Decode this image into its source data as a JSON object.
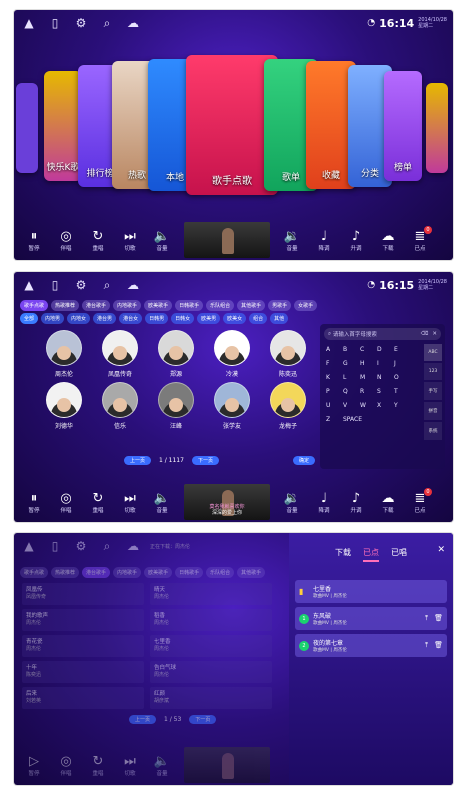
{
  "status": {
    "time1": "16:14",
    "date1": "2014/10/28",
    "week": "星期二",
    "time2": "16:15",
    "date2": "2014/10/28",
    "icons": [
      "android-icon",
      "phone-icon",
      "gear-icon",
      "search-icon",
      "cloud-icon",
      "wifi-icon"
    ]
  },
  "carousel": {
    "left": [
      "快乐K歌",
      "排行榜",
      "热歌",
      "本地"
    ],
    "center": "歌手点歌",
    "right": [
      "歌单",
      "收藏",
      "分类",
      "榜单"
    ]
  },
  "bar": {
    "left": [
      "暂停",
      "伴唱",
      "重唱",
      "切歌",
      "音量"
    ],
    "right": [
      "音量",
      "降调",
      "升调",
      "下载",
      "已点"
    ],
    "badge": "0"
  },
  "video2": {
    "line1": "莫名我就喜欢你",
    "line2": "深深的爱上你"
  },
  "screen2": {
    "tabs": [
      "歌手点歌",
      "热歌推荐",
      "港台歌手",
      "内地歌手",
      "欧美歌手",
      "日韩歌手",
      "乐队组合",
      "其他歌手",
      "男歌手",
      "女歌手"
    ],
    "subtabs": [
      "全部",
      "内地男",
      "内地女",
      "港台男",
      "港台女",
      "日韩男",
      "日韩女",
      "欧美男",
      "欧美女",
      "组合",
      "其他"
    ],
    "singers": [
      "周杰伦",
      "凤凰传奇",
      "郑源",
      "冷漠",
      "陈奕迅",
      "刘德华",
      "信乐",
      "汪峰",
      "张学友",
      "龙梅子"
    ],
    "prev": "上一页",
    "page": "1 / 1117",
    "next": "下一页",
    "ok": "确定",
    "search_placeholder": "请输入首字母搜索",
    "keys": [
      "A",
      "B",
      "C",
      "D",
      "E",
      "F",
      "G",
      "H",
      "I",
      "J",
      "K",
      "L",
      "M",
      "N",
      "O",
      "P",
      "Q",
      "R",
      "S",
      "T",
      "U",
      "V",
      "W",
      "X",
      "Y",
      "Z",
      "SPACE"
    ],
    "side": [
      "ABC",
      "123",
      "手写",
      "拼音",
      "系统"
    ]
  },
  "screen3": {
    "hint": "正在下载：周杰伦",
    "list": [
      {
        "t": "凤凰传",
        "a": "凤凰传奇"
      },
      {
        "t": "晴天",
        "a": "周杰伦"
      },
      {
        "t": "我的歌声",
        "a": "周杰伦"
      },
      {
        "t": "稻香",
        "a": "周杰伦"
      },
      {
        "t": "青花瓷",
        "a": "周杰伦"
      },
      {
        "t": "七里香",
        "a": "周杰伦"
      },
      {
        "t": "十年",
        "a": "陈奕迅"
      },
      {
        "t": "告白气球",
        "a": "周杰伦"
      },
      {
        "t": "后来",
        "a": "刘若英"
      },
      {
        "t": "红颜",
        "a": "胡彦斌"
      }
    ],
    "page": "1 / 53",
    "tabs": [
      "下载",
      "已点",
      "已唱"
    ],
    "songs": [
      {
        "t": "七里香",
        "s": "歌曲MV | 周杰伦"
      },
      {
        "t": "东风破",
        "s": "歌曲MV | 周杰伦"
      },
      {
        "t": "夜的第七章",
        "s": "歌曲MV | 周杰伦"
      }
    ]
  },
  "colors": {
    "accent": "#7a45f0",
    "pink": "#ff6fb9",
    "blue": "#3a7cff"
  }
}
